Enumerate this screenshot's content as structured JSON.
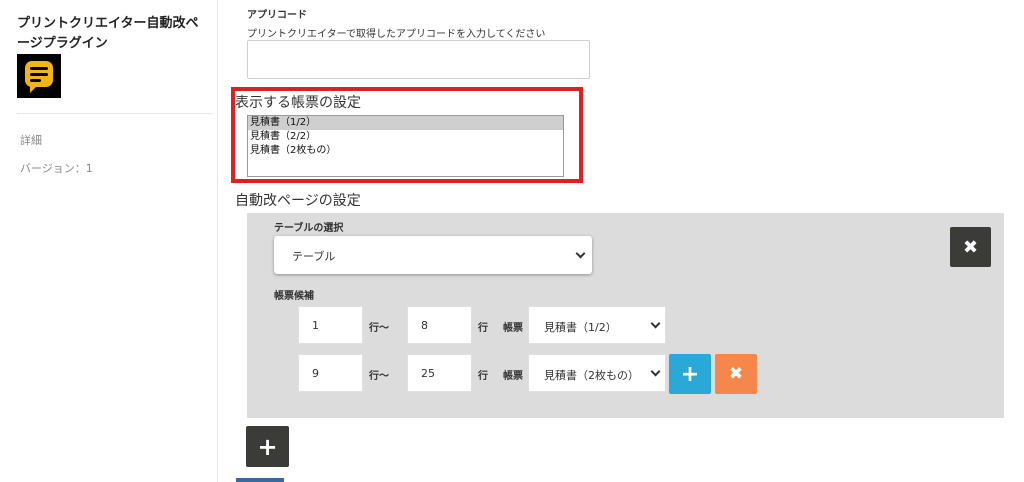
{
  "sidebar": {
    "plugin_name": "プリントクリエイター自動改ページプラグイン",
    "details": "詳細",
    "version": "バージョン：1"
  },
  "app_code": {
    "label": "アプリコード",
    "help": "プリントクリエイターで取得したアプリコードを入力してください",
    "value": ""
  },
  "form_settings": {
    "title": "表示する帳票の設定",
    "options": [
      "見積書（1/2）",
      "見積書（2/2）",
      "見積書（2枚もの）"
    ],
    "selected_index": 0
  },
  "autopage": {
    "title": "自動改ページの設定",
    "table_select_label": "テーブルの選択",
    "table_select_value": "テーブル",
    "candidate_label": "帳票候補",
    "rows": [
      {
        "from": "1",
        "from_unit": "行～",
        "to": "8",
        "to_unit": "行",
        "form_label": "帳票",
        "form_value": "見積書（1/2）"
      },
      {
        "from": "9",
        "from_unit": "行～",
        "to": "25",
        "to_unit": "行",
        "form_label": "帳票",
        "form_value": "見積書（2枚もの）"
      }
    ]
  },
  "buttons": {
    "remove_row": "✖",
    "add_candidate": "+",
    "remove_candidate": "✖",
    "add_row": "+"
  },
  "colors": {
    "highlight": "#e02020",
    "panel": "#dcdcdc",
    "dark_button": "#3b3b37",
    "add_button": "#2aa9d9",
    "remove_button": "#f5864c",
    "logo_accent": "#f2b31b"
  }
}
